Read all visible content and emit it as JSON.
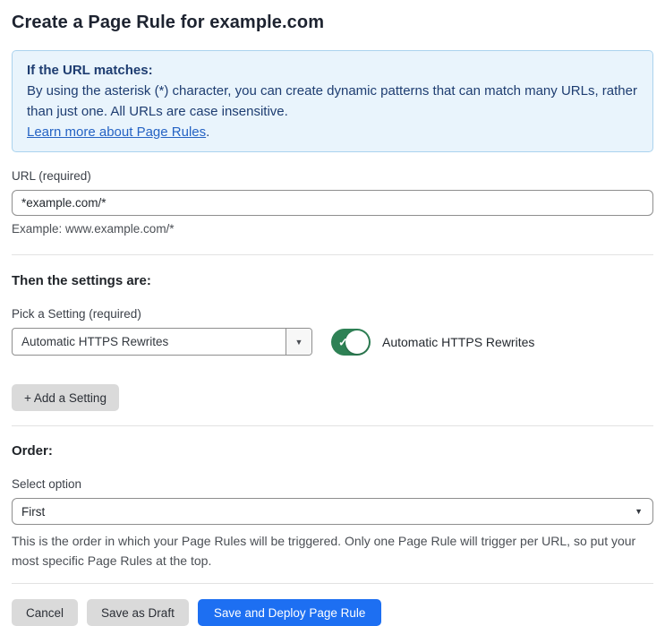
{
  "page": {
    "title": "Create a Page Rule for example.com"
  },
  "info_box": {
    "heading": "If the URL matches:",
    "body": "By using the asterisk (*) character, you can create dynamic patterns that can match many URLs, rather than just one. All URLs are case insensitive.",
    "link_label": "Learn more about Page Rules",
    "link_suffix": "."
  },
  "url_field": {
    "label": "URL (required)",
    "value": "*example.com/*",
    "helper": "Example: www.example.com/*"
  },
  "settings_section": {
    "heading": "Then the settings are:",
    "picker_label": "Pick a Setting (required)",
    "picker_value": "Automatic HTTPS Rewrites",
    "toggle_label": "Automatic HTTPS Rewrites",
    "toggle_state": "on",
    "add_setting_button": "+ Add a Setting"
  },
  "order_section": {
    "heading": "Order:",
    "select_label": "Select option",
    "select_value": "First",
    "helper": "This is the order in which your Page Rules will be triggered. Only one Page Rule will trigger per URL, so put your most specific Page Rules at the top."
  },
  "footer": {
    "cancel_label": "Cancel",
    "save_draft_label": "Save as Draft",
    "save_deploy_label": "Save and Deploy Page Rule"
  },
  "icons": {
    "dropdown_arrow": "▼",
    "select_arrow": "▼",
    "check": "✓"
  },
  "colors": {
    "info_bg": "#e9f4fc",
    "info_border": "#abd3ee",
    "info_text": "#1e3d71",
    "link_blue": "#2563c4",
    "toggle_green": "#2e8155",
    "primary_blue": "#1d6ff2",
    "button_gray": "#dadada"
  }
}
